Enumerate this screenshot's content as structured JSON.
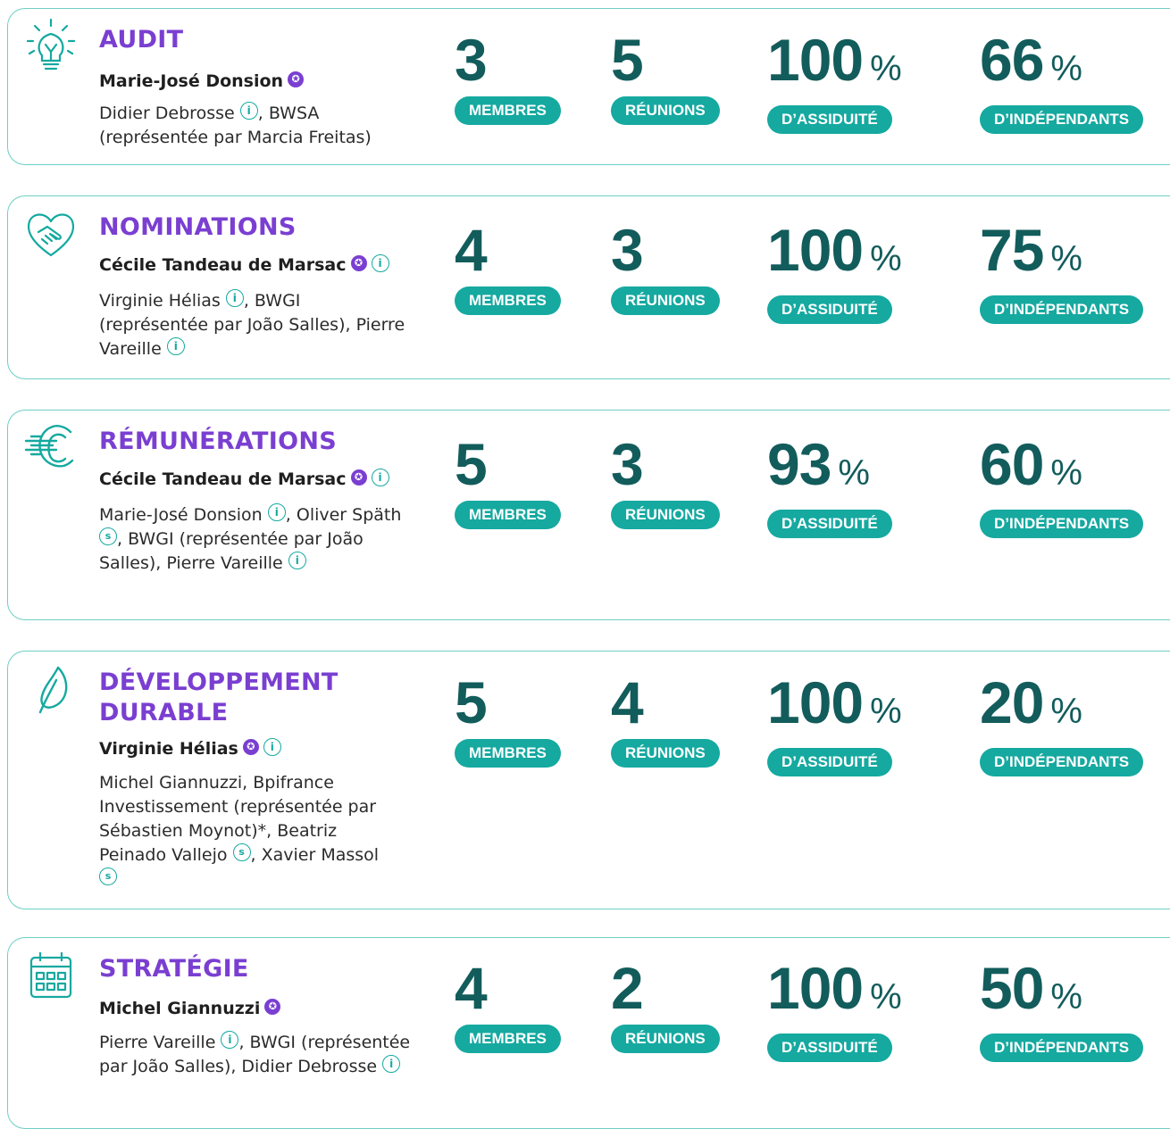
{
  "committees": [
    {
      "icon": "lightbulb-icon",
      "title": "AUDIT",
      "chair": "Marie-José Donsion",
      "chair_badges": [
        "chair"
      ],
      "members": [
        {
          "text": "Didier Debrosse"
        },
        {
          "badge": "i"
        },
        {
          "text": ", BWSA (représentée par Marcia Freitas)"
        }
      ],
      "stats": {
        "membres": "3",
        "reunions": "5",
        "assiduite": "100",
        "independants": "66"
      }
    },
    {
      "icon": "handshake-heart-icon",
      "title": "NOMINATIONS",
      "chair": "Cécile Tandeau de Marsac",
      "chair_badges": [
        "chair",
        "i"
      ],
      "members": [
        {
          "text": "Virginie Hélias "
        },
        {
          "badge": "i"
        },
        {
          "text": ", BWGI (représentée par João Salles), Pierre Vareille "
        },
        {
          "badge": "i"
        }
      ],
      "stats": {
        "membres": "4",
        "reunions": "3",
        "assiduite": "100",
        "independants": "75"
      }
    },
    {
      "icon": "euro-icon",
      "title": "RÉMUNÉRATIONS",
      "chair": "Cécile Tandeau de Marsac",
      "chair_badges": [
        "chair",
        "i"
      ],
      "members": [
        {
          "text": "Marie-José Donsion "
        },
        {
          "badge": "i"
        },
        {
          "text": ", Oliver Späth "
        },
        {
          "badge": "s"
        },
        {
          "text": ", BWGI (représentée par João Salles), Pierre Vareille "
        },
        {
          "badge": "i"
        }
      ],
      "stats": {
        "membres": "5",
        "reunions": "3",
        "assiduite": "93",
        "independants": "60"
      }
    },
    {
      "icon": "leaf-icon",
      "title": "DÉVELOPPEMENT DURABLE",
      "chair": "Virginie Hélias",
      "chair_badges": [
        "chair",
        "i"
      ],
      "members": [
        {
          "text": "Michel Giannuzzi, Bpifrance Investissement (représentée par Sébastien Moynot)*, Beatriz Peinado Vallejo "
        },
        {
          "badge": "s"
        },
        {
          "text": ", Xavier Massol "
        },
        {
          "badge": "s"
        }
      ],
      "stats": {
        "membres": "5",
        "reunions": "4",
        "assiduite": "100",
        "independants": "20"
      }
    },
    {
      "icon": "calendar-icon",
      "title": "STRATÉGIE",
      "chair": "Michel Giannuzzi",
      "chair_badges": [
        "chair"
      ],
      "members": [
        {
          "text": "Pierre Vareille "
        },
        {
          "badge": "i"
        },
        {
          "text": ", BWGI (représentée par João Salles), Didier Debrosse "
        },
        {
          "badge": "i"
        }
      ],
      "stats": {
        "membres": "4",
        "reunions": "2",
        "assiduite": "100",
        "independants": "50"
      }
    }
  ],
  "labels": {
    "membres": "MEMBRES",
    "reunions": "RÉUNIONS",
    "assiduite": "D’ASSIDUITÉ",
    "independants": "D’INDÉPENDANTS",
    "percent": "%",
    "chair_badge_glyph": "✪",
    "info_badge_glyph": "i",
    "s_badge_glyph": "s"
  },
  "colors": {
    "title": "#7a3fd1",
    "number": "#135c5c",
    "pill": "#15a9a0",
    "border": "#6fcfc6"
  }
}
